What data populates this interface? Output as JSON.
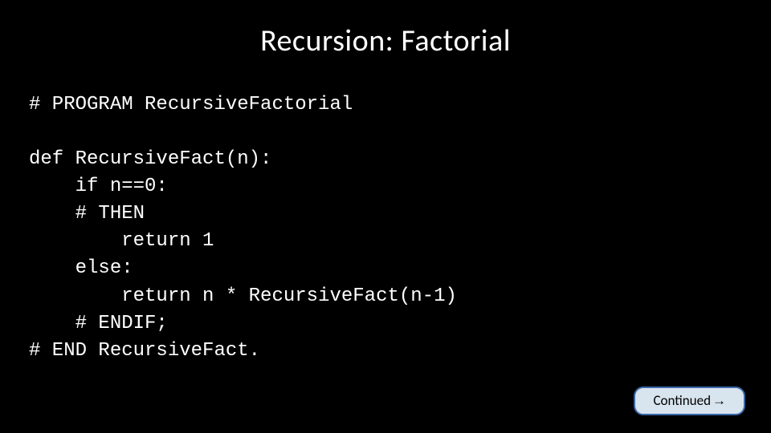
{
  "title": "Recursion: Factorial",
  "code": {
    "l1": "# PROGRAM RecursiveFactorial",
    "l2": "",
    "l3": "def RecursiveFact(n):",
    "l4": "    if n==0:",
    "l5": "    # THEN",
    "l6": "        return 1",
    "l7": "    else:",
    "l8": "        return n * RecursiveFact(n-1)",
    "l9": "    # ENDIF;",
    "l10": "# END RecursiveFact."
  },
  "continued": {
    "label": "Continued ",
    "arrow": "→"
  }
}
